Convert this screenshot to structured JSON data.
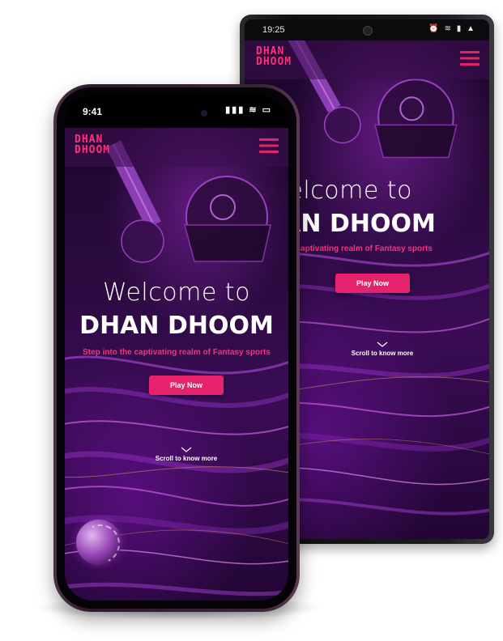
{
  "colors": {
    "accent": "#e5226b",
    "tagline": "#ff2e7a",
    "background_purple": "#2a0a3e"
  },
  "android": {
    "status": {
      "time": "19:25",
      "icons": "⏰ ≋ ▮ ▲"
    },
    "logo": {
      "line1": "DHAN",
      "line2": "DHOOM"
    },
    "menu_icon": "hamburger-icon",
    "hero": {
      "welcome": "Welcome to",
      "title": "DHAN DHOOM",
      "tagline": "Step into the captivating realm of Fantasy sports"
    },
    "play_label": "Play Now",
    "scroll_label": "Scroll to know more"
  },
  "iphone": {
    "status": {
      "time": "9:41",
      "icons": "▮▮▮ ≋ ▭"
    },
    "logo": {
      "line1": "DHAN",
      "line2": "DHOOM"
    },
    "menu_icon": "hamburger-icon",
    "hero": {
      "welcome": "Welcome to",
      "title": "DHAN DHOOM",
      "tagline": "Step into the captivating realm of Fantasy sports"
    },
    "play_label": "Play Now",
    "scroll_label": "Scroll to know more"
  }
}
